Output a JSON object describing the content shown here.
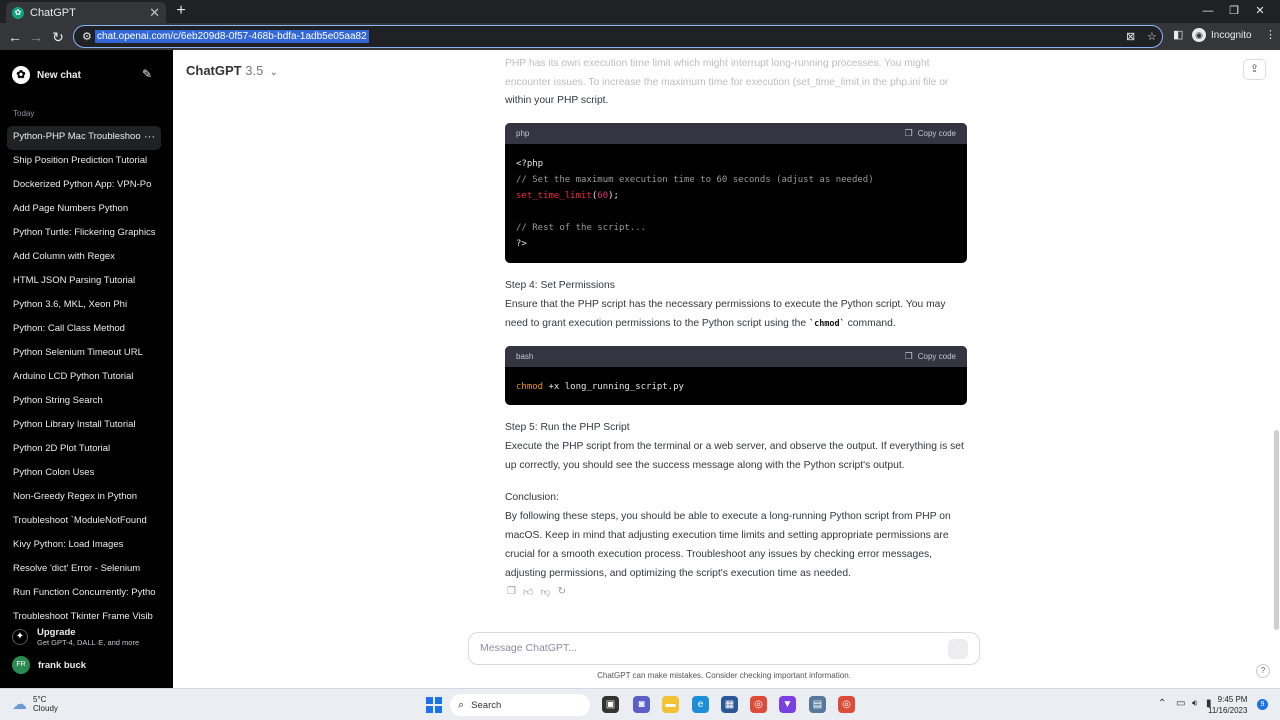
{
  "browser": {
    "tab_title": "ChatGPT",
    "tab_close": "✕",
    "new_tab": "+",
    "url": "chat.openai.com/c/6eb209d8-0f57-468b-bdfa-1adb5e05aa82",
    "profile_label": "Incognito"
  },
  "sidebar": {
    "new_chat_label": "New chat",
    "section_label": "Today",
    "items": [
      {
        "label": "Python-PHP Mac Troubleshoo"
      },
      {
        "label": "Ship Position Prediction Tutorial"
      },
      {
        "label": "Dockerized Python App: VPN-Po"
      },
      {
        "label": "Add Page Numbers Python"
      },
      {
        "label": "Python Turtle: Flickering Graphics"
      },
      {
        "label": "Add Column with Regex"
      },
      {
        "label": "HTML JSON Parsing Tutorial"
      },
      {
        "label": "Python 3.6, MKL, Xeon Phi"
      },
      {
        "label": "Python: Call Class Method"
      },
      {
        "label": "Python Selenium Timeout URL"
      },
      {
        "label": "Arduino LCD Python Tutorial"
      },
      {
        "label": "Python String Search"
      },
      {
        "label": "Python Library Install Tutorial"
      },
      {
        "label": "Python 2D Plot Tutorial"
      },
      {
        "label": "Python Colon Uses"
      },
      {
        "label": "Non-Greedy Regex in Python"
      },
      {
        "label": "Troubleshoot `ModuleNotFound"
      },
      {
        "label": "Kivy Python: Load Images"
      },
      {
        "label": "Resolve 'dict' Error - Selenium"
      },
      {
        "label": "Run Function Concurrently: Pytho"
      },
      {
        "label": "Troubleshoot Tkinter Frame Visib"
      }
    ],
    "active_index": 0,
    "upgrade_title": "Upgrade",
    "upgrade_subtitle": "Get GPT-4, DALL·E, and more",
    "user_initials": "FR",
    "user_name": "frank buck"
  },
  "header": {
    "model_name": "ChatGPT",
    "model_version": "3.5"
  },
  "conversation": {
    "faded_text": "PHP has its own execution time limit which might interrupt long-running processes. You might encounter issues. To increase the maximum time for execution (set_time_limit in the php.ini file or",
    "intro_tail": "within your PHP script.",
    "php_block": {
      "language": "php",
      "copy_label": "Copy code",
      "line1": "<?php",
      "line2": "// Set the maximum execution time to 60 seconds (adjust as needed)",
      "line3_fn": "set_time_limit",
      "line3_open": "(",
      "line3_num": "60",
      "line3_close": ");",
      "line5": "// Rest of the script...",
      "line6": "?>"
    },
    "step4_title": "Step 4: Set Permissions",
    "step4_text": "Ensure that the PHP script has the necessary permissions to execute the Python script. You may need to grant execution permissions to the Python script using the",
    "step4_code": "`chmod`",
    "step4_tail": "command.",
    "bash_block": {
      "language": "bash",
      "copy_label": "Copy code",
      "cmd": "chmod",
      "args": " +x long_running_script.py"
    },
    "step5_title": "Step 5: Run the PHP Script",
    "step5_text": "Execute the PHP script from the terminal or a web server, and observe the output. If everything is set up correctly, you should see the success message along with the Python script's output.",
    "conclusion_title": "Conclusion:",
    "conclusion_text": "By following these steps, you should be able to execute a long-running Python script from PHP on macOS. Keep in mind that adjusting execution time limits and setting appropriate permissions are crucial for a smooth execution process. Troubleshoot any issues by checking error messages, adjusting permissions, and optimizing the script's execution time as needed."
  },
  "composer": {
    "placeholder": "Message ChatGPT...",
    "disclaimer": "ChatGPT can make mistakes. Consider checking important information.",
    "help": "?"
  },
  "taskbar": {
    "temperature": "5°C",
    "condition": "Cloudy",
    "search_label": "Search",
    "time": "9:45 PM",
    "date": "11/16/2023",
    "notification_count": "9"
  }
}
